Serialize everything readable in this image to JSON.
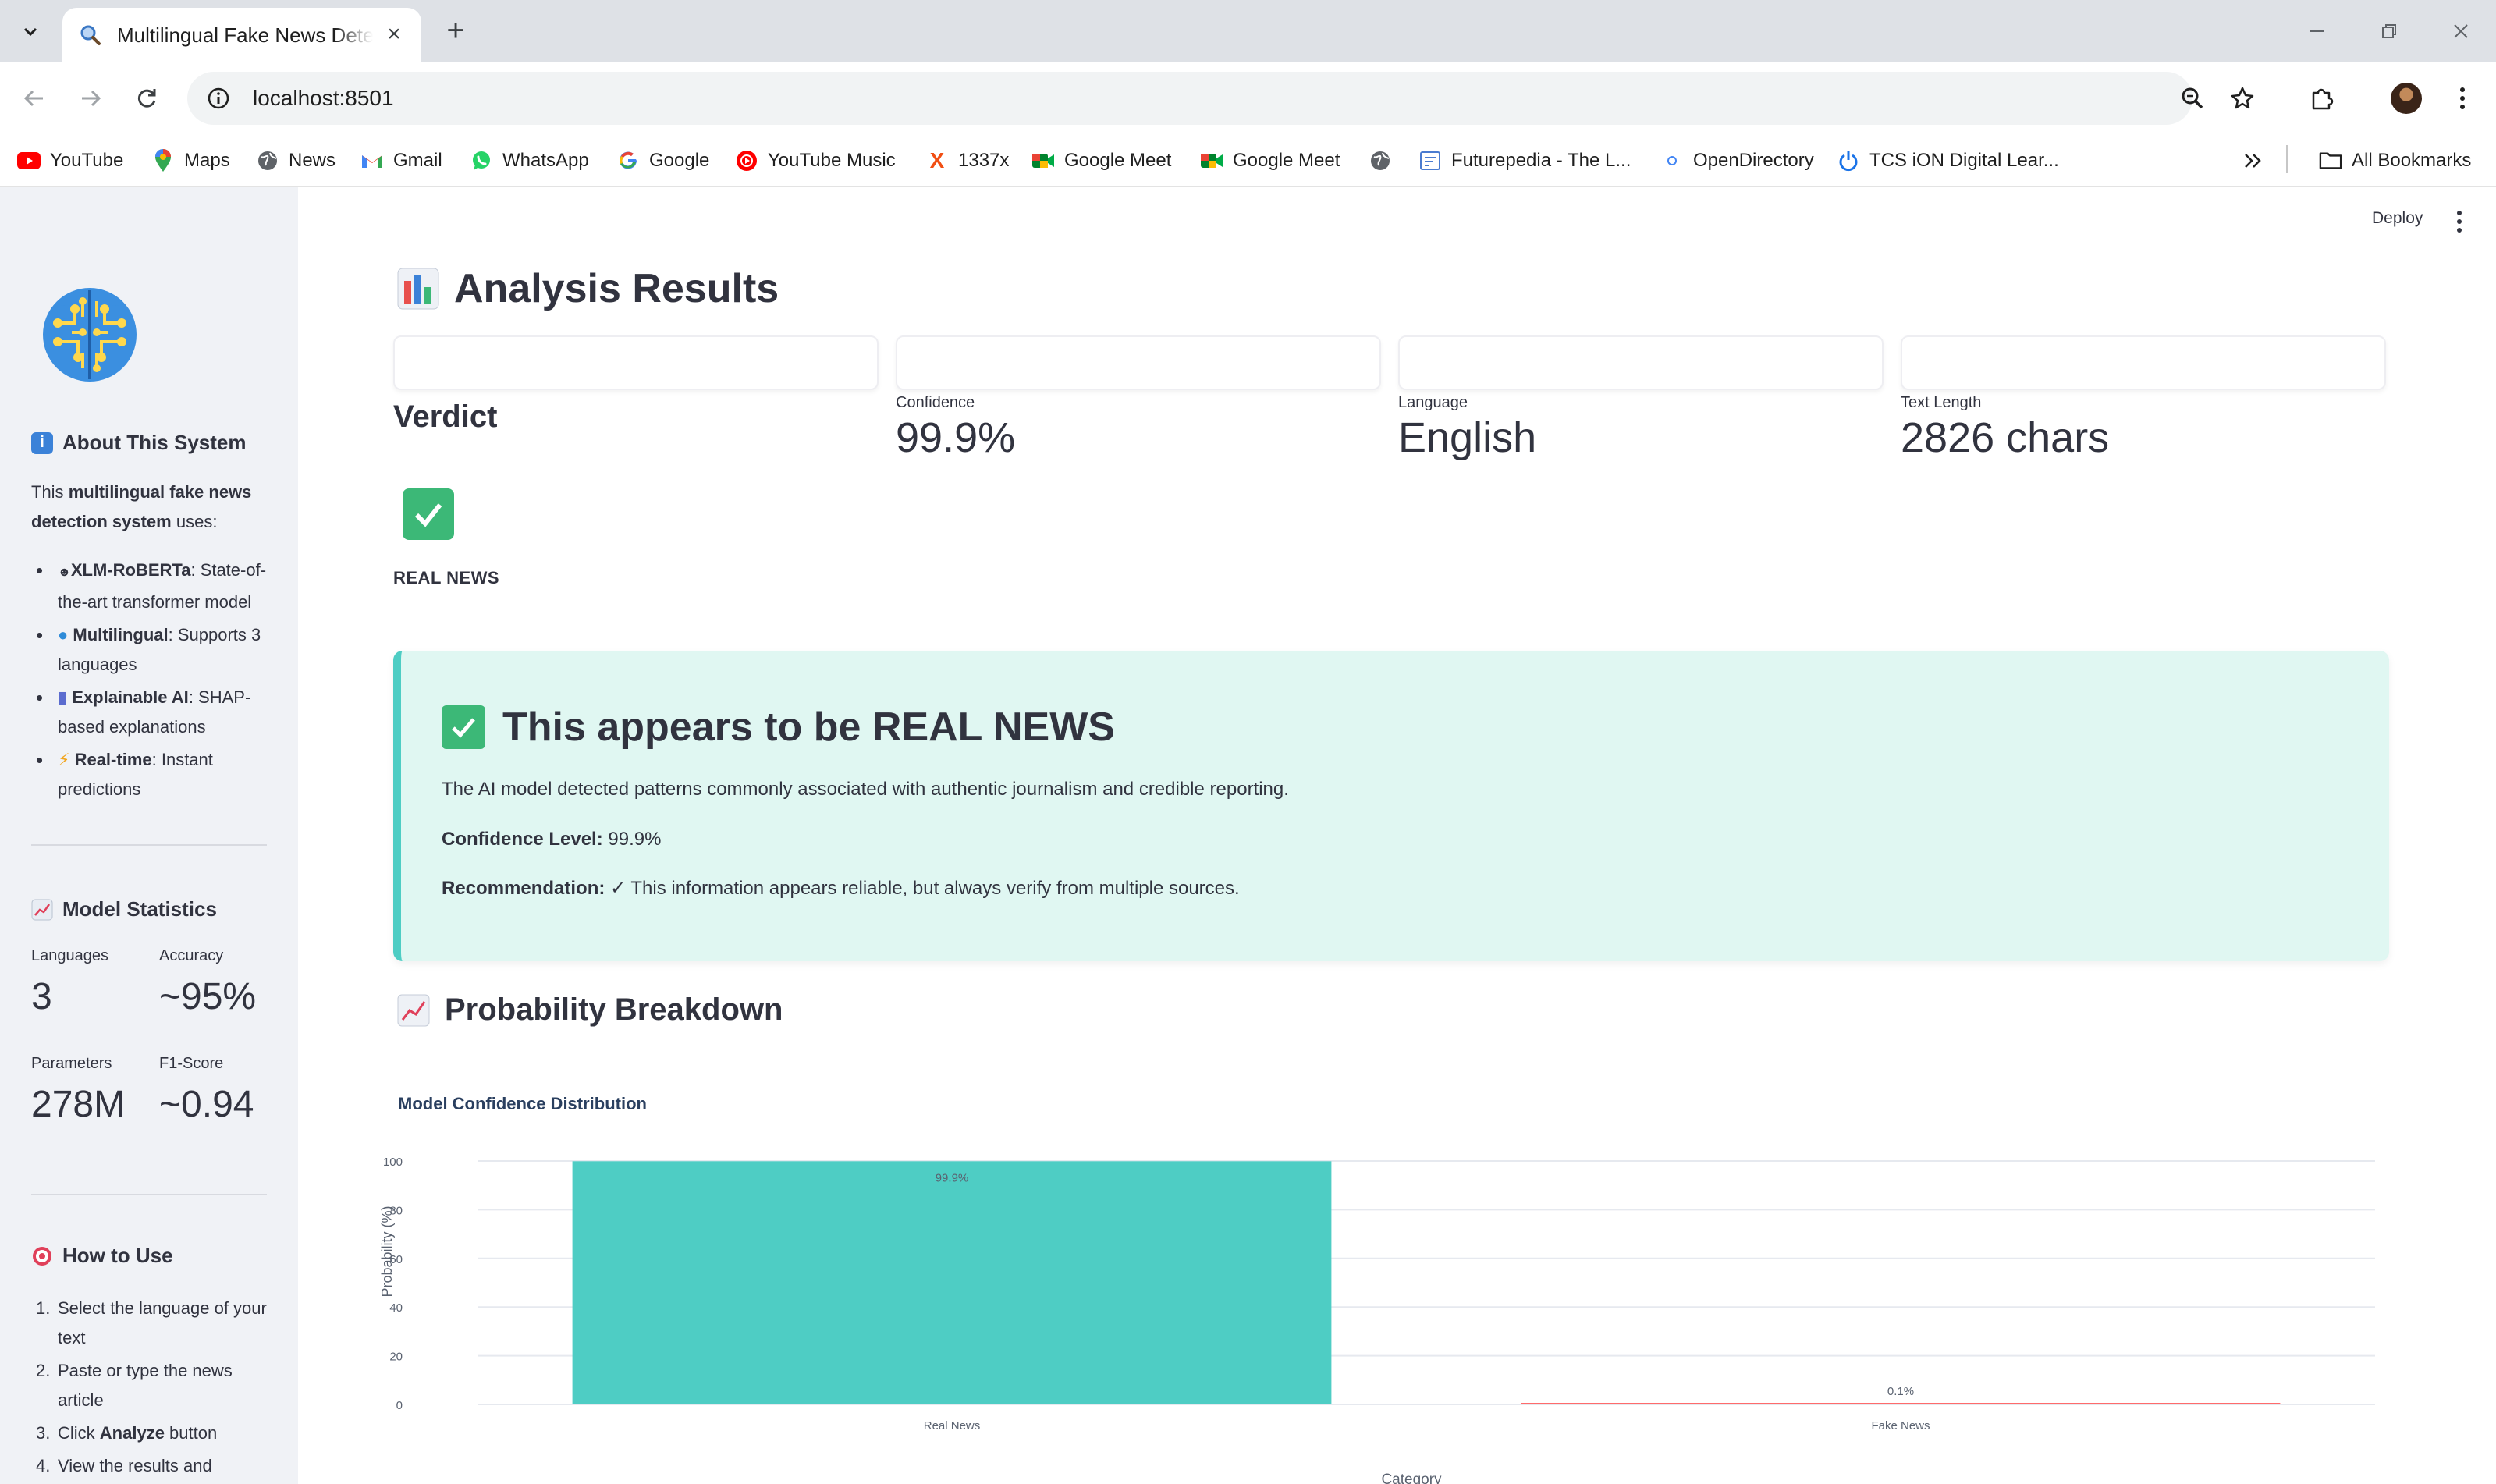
{
  "browser": {
    "tab_title": "Multilingual Fake News Detector",
    "url": "localhost:8501",
    "bookmarks": [
      {
        "label": "YouTube",
        "icon": "youtube-icon"
      },
      {
        "label": "Maps",
        "icon": "maps-icon"
      },
      {
        "label": "News",
        "icon": "globe-icon"
      },
      {
        "label": "Gmail",
        "icon": "gmail-icon"
      },
      {
        "label": "WhatsApp",
        "icon": "whatsapp-icon"
      },
      {
        "label": "Google",
        "icon": "google-icon"
      },
      {
        "label": "YouTube Music",
        "icon": "youtube-music-icon"
      },
      {
        "label": "1337x",
        "icon": "x-icon"
      },
      {
        "label": "Google Meet",
        "icon": "meet-icon"
      },
      {
        "label": "Google Meet",
        "icon": "meet-icon"
      },
      {
        "label": "",
        "icon": "globe-icon"
      },
      {
        "label": "Futurepedia - The L...",
        "icon": "futurepedia-icon"
      },
      {
        "label": "OpenDirectory",
        "icon": "opendirectory-icon"
      },
      {
        "label": "TCS iON Digital Lear...",
        "icon": "power-icon"
      }
    ],
    "all_bookmarks": "All Bookmarks"
  },
  "app": {
    "deploy_label": "Deploy"
  },
  "sidebar": {
    "about_title": "About This System",
    "about_intro_pre": "This ",
    "about_intro_bold": "multilingual fake news detection system",
    "about_intro_post": " uses:",
    "features": [
      {
        "icon": "robot-icon",
        "bold": "XLM-RoBERTa",
        "text": ": State-of-the-art transformer model"
      },
      {
        "icon": "globe-icon",
        "bold": "Multilingual",
        "text": ": Supports 3 languages"
      },
      {
        "icon": "bar-chart-icon",
        "bold": "Explainable AI",
        "text": ": SHAP-based explanations"
      },
      {
        "icon": "lightning-icon",
        "bold": "Real-time",
        "text": ": Instant predictions"
      }
    ],
    "stats_title": "Model Statistics",
    "stats": [
      {
        "label": "Languages",
        "value": "3"
      },
      {
        "label": "Accuracy",
        "value": "~95%"
      },
      {
        "label": "Parameters",
        "value": "278M"
      },
      {
        "label": "F1-Score",
        "value": "~0.94"
      }
    ],
    "howto_title": "How to Use",
    "steps": [
      {
        "num": "1.",
        "text": "Select the language of your text"
      },
      {
        "num": "2.",
        "text": "Paste or type the news article"
      },
      {
        "num": "3.",
        "pre": "Click ",
        "bold": "Analyze",
        "post": " button"
      },
      {
        "num": "4.",
        "text": "View the results and"
      }
    ]
  },
  "results": {
    "title": "Analysis Results",
    "verdict_title": "Verdict",
    "verdict_label": "REAL NEWS",
    "metrics": [
      {
        "label": "Confidence",
        "value": "99.9%"
      },
      {
        "label": "Language",
        "value": "English"
      },
      {
        "label": "Text Length",
        "value": "2826 chars"
      }
    ],
    "box": {
      "title": "This appears to be REAL NEWS",
      "description": "The AI model detected patterns commonly associated with authentic journalism and credible reporting.",
      "confidence_label": "Confidence Level:",
      "confidence_value": " 99.9%",
      "recommendation_label": "Recommendation:",
      "recommendation_value": " ✓ This information appears reliable, but always verify from multiple sources."
    }
  },
  "breakdown": {
    "title": "Probability Breakdown"
  },
  "colors": {
    "real": "#4ecdc4",
    "fake": "#ff6b6b",
    "sidebar_bg": "#f0f2f6",
    "result_bg": "#e0f7f2"
  },
  "chart_data": {
    "type": "bar",
    "title": "Model Confidence Distribution",
    "xlabel": "Category",
    "ylabel": "Probability (%)",
    "categories": [
      "Real News",
      "Fake News"
    ],
    "values": [
      99.9,
      0.1
    ],
    "data_labels": [
      "99.9%",
      "0.1%"
    ],
    "colors": [
      "#4ecdc4",
      "#ff6b6b"
    ],
    "ylim": [
      0,
      100
    ],
    "yticks": [
      0,
      20,
      40,
      60,
      80,
      100
    ],
    "grid": true
  }
}
